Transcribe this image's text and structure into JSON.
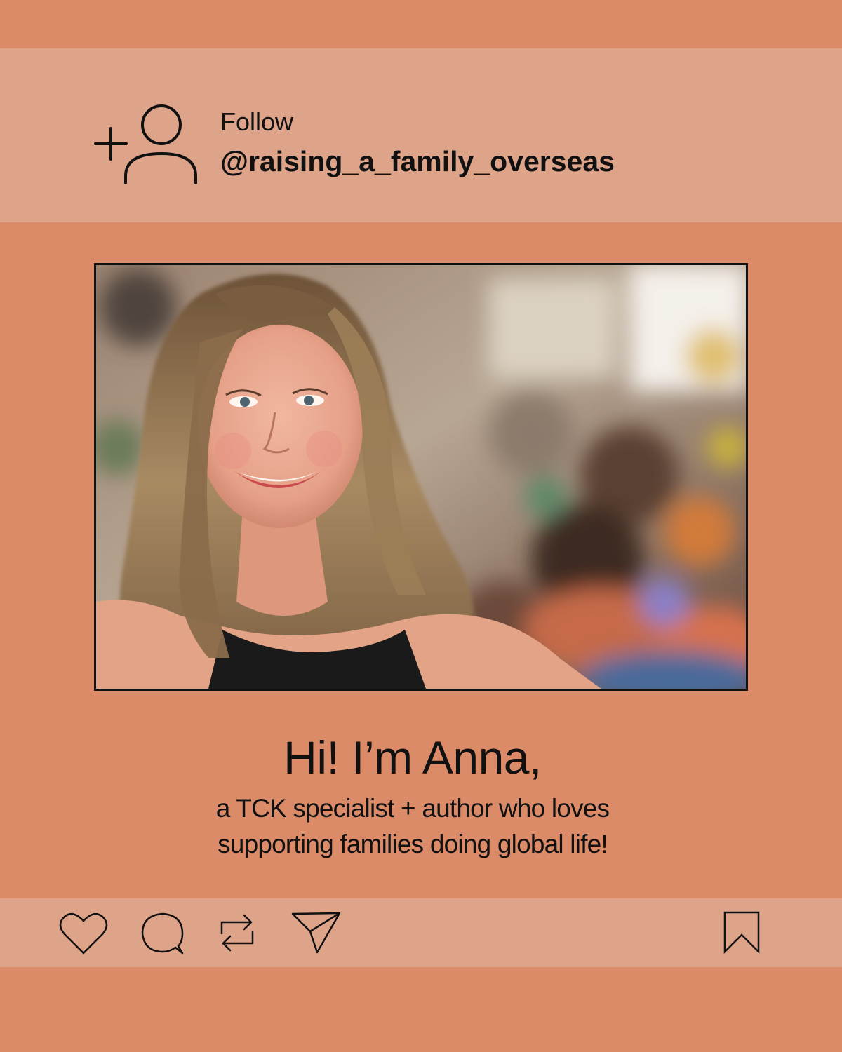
{
  "header": {
    "follow_label": "Follow",
    "handle": "@raising_a_family_overseas",
    "follow_icon": "add-user-icon"
  },
  "photo": {
    "description_kind": "portrait-photo"
  },
  "intro": {
    "headline": "Hi! I’m Anna,",
    "tagline_line1": "a TCK specialist + author who loves",
    "tagline_line2": "supporting families doing global life!"
  },
  "actions": {
    "icons": [
      "heart-icon",
      "comment-icon",
      "repost-icon",
      "send-icon",
      "bookmark-icon"
    ]
  },
  "colors": {
    "background": "#dc8b69",
    "band": "#dea48a",
    "ink": "#111111"
  }
}
